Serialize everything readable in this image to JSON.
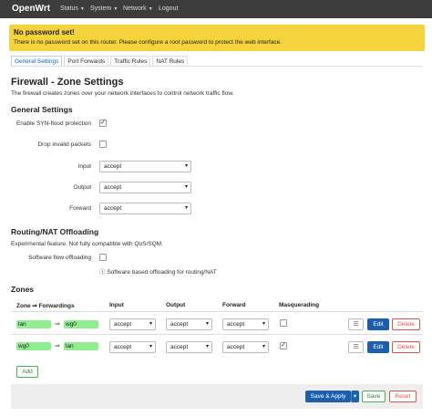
{
  "header": {
    "brand": "OpenWrt",
    "menu": [
      {
        "label": "Status"
      },
      {
        "label": "System"
      },
      {
        "label": "Network"
      },
      {
        "label": "Logout"
      }
    ]
  },
  "alert": {
    "title": "No password set!",
    "message": "There is no password set on this router. Please configure a root password to protect the web interface."
  },
  "tabs": [
    "General Settings",
    "Port Forwards",
    "Traffic Rules",
    "NAT Rules"
  ],
  "page": {
    "title": "Firewall - Zone Settings",
    "description": "The firewall creates zones over your network interfaces to control network traffic flow."
  },
  "general": {
    "heading": "General Settings",
    "syn_flood_label": "Enable SYN-flood protection",
    "syn_flood_checked": true,
    "drop_invalid_label": "Drop invalid packets",
    "drop_invalid_checked": false,
    "input_label": "Input",
    "input_value": "accept",
    "output_label": "Output",
    "output_value": "accept",
    "forward_label": "Forward",
    "forward_value": "accept"
  },
  "offload": {
    "heading": "Routing/NAT Offloading",
    "description": "Experimental feature. Not fully compatible with QoS/SQM.",
    "sw_label": "Software flow offloading",
    "sw_checked": false,
    "sw_hint": "Software based offloading for routing/NAT"
  },
  "zones": {
    "heading": "Zones",
    "columns": [
      "Zone ⇒ Forwardings",
      "Input",
      "Output",
      "Forward",
      "Masquerading"
    ],
    "rows": [
      {
        "zone": "lan",
        "arrow": "⇒",
        "forward_to": "wg0",
        "input": "accept",
        "output": "accept",
        "forward": "accept",
        "masq": false
      },
      {
        "zone": "wg0",
        "arrow": "⇒",
        "forward_to": "lan",
        "input": "accept",
        "output": "accept",
        "forward": "accept",
        "masq": true
      }
    ],
    "menu_icon": "☰",
    "edit_label": "Edit",
    "delete_label": "Delete",
    "add_label": "Add"
  },
  "footer": {
    "save_apply_label": "Save & Apply",
    "save_label": "Save",
    "reset_label": "Reset"
  },
  "colors": {
    "topbar": "#3c3c3c",
    "alert": "#f5d33b",
    "zone_badge": "#90ee90",
    "primary": "#1c5fad",
    "danger": "#d9534f",
    "success": "#4caf50"
  }
}
